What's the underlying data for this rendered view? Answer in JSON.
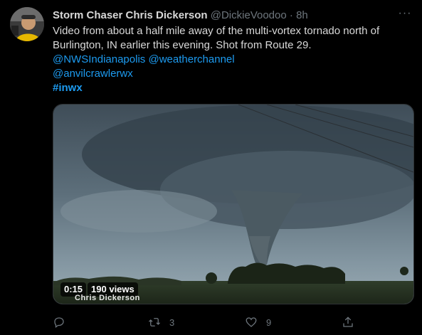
{
  "tweet": {
    "author_name": "Storm Chaser Chris Dickerson",
    "handle": "@DickieVoodoo",
    "separator": "·",
    "time": "8h",
    "more_label": "···",
    "text_line1": "Video from about a half mile away of the multi-vortex tornado north of",
    "text_line2": "Burlington, IN earlier this evening. Shot from Route 29.",
    "mention1": "@NWSIndianapolis",
    "mention2": "@weatherchannel",
    "mention3": "@anvilcrawlerwx",
    "hashtag": "#inwx"
  },
  "media": {
    "duration": "0:15",
    "views": "190 views",
    "watermark": "Chris Dickerson"
  },
  "actions": {
    "reply_count": "",
    "retweet_count": "3",
    "like_count": "9"
  },
  "colors": {
    "background": "#000000",
    "text": "#d9d9d9",
    "muted": "#6e767d",
    "link": "#1d9bf0"
  },
  "icons": [
    "reply-icon",
    "retweet-icon",
    "like-icon",
    "share-icon",
    "more-icon"
  ]
}
